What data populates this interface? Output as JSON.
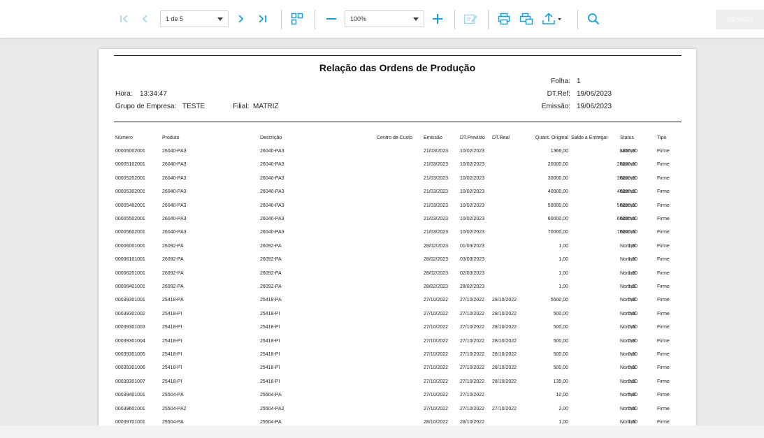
{
  "toolbar": {
    "page_select": "1 de 5",
    "zoom_select": "100%",
    "design_label": "DESIGN",
    "icons": [
      "first-page-icon",
      "prev-page-icon",
      "next-page-icon",
      "last-page-icon",
      "thumbnails-icon",
      "zoom-out-icon",
      "zoom-in-icon",
      "edit-icon",
      "print-icon",
      "print-preview-icon",
      "export-icon",
      "search-icon"
    ]
  },
  "report": {
    "title": "Relação das Ordens de Produção",
    "folha_label": "Folha:",
    "folha_value": "1",
    "hora_label": "Hora:",
    "hora_value": "13:34:47",
    "dtref_label": "DT.Ref:",
    "dtref_value": "19/06/2023",
    "grupo_label": "Grupo de Empresa:",
    "grupo_value": "TESTE",
    "filial_label": "Filial:",
    "filial_value": "MATRIZ",
    "emissao_label": "Emissão:",
    "emissao_value": "19/06/2023",
    "columns": [
      "Número",
      "Produto",
      "Descrição",
      "Centro de Custo",
      "Emissão",
      "DT.Previsto",
      "DT.Real",
      "Quant. Original",
      "Saldo a Entregar",
      "Status",
      "Tipo"
    ],
    "rows": [
      [
        "00005002001",
        "26040-PA3",
        "26040-PA3",
        "",
        "21/03/2023",
        "10/02/2023",
        "",
        "1366,00",
        "1366,00",
        "Normal",
        "Firme"
      ],
      [
        "00005102001",
        "26040-PA3",
        "26040-PA3",
        "",
        "21/03/2023",
        "10/02/2023",
        "",
        "20000,00",
        "20000,00",
        "Normal",
        "Firme"
      ],
      [
        "00005202001",
        "26040-PA3",
        "26040-PA3",
        "",
        "21/03/2023",
        "10/02/2023",
        "",
        "30000,00",
        "30000,00",
        "Normal",
        "Firme"
      ],
      [
        "00005302001",
        "26040-PA3",
        "26040-PA3",
        "",
        "21/03/2023",
        "10/02/2023",
        "",
        "40000,00",
        "40000,00",
        "Normal",
        "Firme"
      ],
      [
        "00005402001",
        "26040-PA3",
        "26040-PA3",
        "",
        "21/03/2023",
        "10/02/2023",
        "",
        "50000,00",
        "50000,00",
        "Normal",
        "Firme"
      ],
      [
        "00005502001",
        "26040-PA3",
        "26040-PA3",
        "",
        "21/03/2023",
        "10/02/2023",
        "",
        "60000,00",
        "60000,00",
        "Normal",
        "Firme"
      ],
      [
        "00005602001",
        "26040-PA3",
        "26040-PA3",
        "",
        "21/03/2023",
        "10/02/2023",
        "",
        "70000,00",
        "70000,00",
        "Normal",
        "Firme"
      ],
      [
        "00006001001",
        "26092-PA",
        "26092-PA",
        "",
        "28/02/2023",
        "01/03/2023",
        "",
        "1,00",
        "1,00",
        "Normal",
        "Firme"
      ],
      [
        "00006101001",
        "26092-PA",
        "26092-PA",
        "",
        "28/02/2023",
        "03/03/2023",
        "",
        "1,00",
        "1,00",
        "Normal",
        "Firme"
      ],
      [
        "00006201001",
        "26092-PA",
        "26092-PA",
        "",
        "28/02/2023",
        "02/03/2023",
        "",
        "1,00",
        "1,00",
        "Normal",
        "Firme"
      ],
      [
        "00006401001",
        "26092-PA",
        "26092-PA",
        "",
        "28/02/2023",
        "28/02/2023",
        "",
        "1,00",
        "1,00",
        "Normal",
        "Firme"
      ],
      [
        "00039301001",
        "25418-PA",
        "25418-PA",
        "",
        "27/10/2022",
        "27/10/2022",
        "28/10/2022",
        "5600,00",
        "0,00",
        "Normal",
        "Firme"
      ],
      [
        "00039301002",
        "25418-PI",
        "25418-PI",
        "",
        "27/10/2022",
        "27/10/2022",
        "28/10/2022",
        "500,00",
        "0,00",
        "Normal",
        "Firme"
      ],
      [
        "00039301003",
        "25418-PI",
        "25418-PI",
        "",
        "27/10/2022",
        "27/10/2022",
        "28/10/2022",
        "500,00",
        "0,00",
        "Normal",
        "Firme"
      ],
      [
        "00039301004",
        "25418-PI",
        "25418-PI",
        "",
        "27/10/2022",
        "27/10/2022",
        "28/10/2022",
        "500,00",
        "0,00",
        "Normal",
        "Firme"
      ],
      [
        "00039301005",
        "25418-PI",
        "25418-PI",
        "",
        "27/10/2022",
        "27/10/2022",
        "28/10/2022",
        "500,00",
        "0,00",
        "Normal",
        "Firme"
      ],
      [
        "00039301006",
        "25418-PI",
        "25418-PI",
        "",
        "27/10/2022",
        "27/10/2022",
        "28/10/2022",
        "500,00",
        "0,00",
        "Normal",
        "Firme"
      ],
      [
        "00039301007",
        "25418-PI",
        "25418-PI",
        "",
        "27/10/2022",
        "27/10/2022",
        "28/10/2022",
        "135,00",
        "0,00",
        "Normal",
        "Firme"
      ],
      [
        "00039401001",
        "25504-PA",
        "25504-PA",
        "",
        "27/10/2022",
        "27/10/2022",
        "",
        "10,00",
        "5,00",
        "Normal",
        "Firme"
      ],
      [
        "00039601001",
        "25504-PA2",
        "25504-PA2",
        "",
        "27/10/2022",
        "27/10/2022",
        "27/10/2022",
        "2,00",
        "0,00",
        "Normal",
        "Firme"
      ],
      [
        "00039701001",
        "25504-PA",
        "25504-PA",
        "",
        "28/10/2022",
        "28/10/2022",
        "",
        "1,00",
        "1,00",
        "Normal",
        "Firme"
      ]
    ]
  }
}
